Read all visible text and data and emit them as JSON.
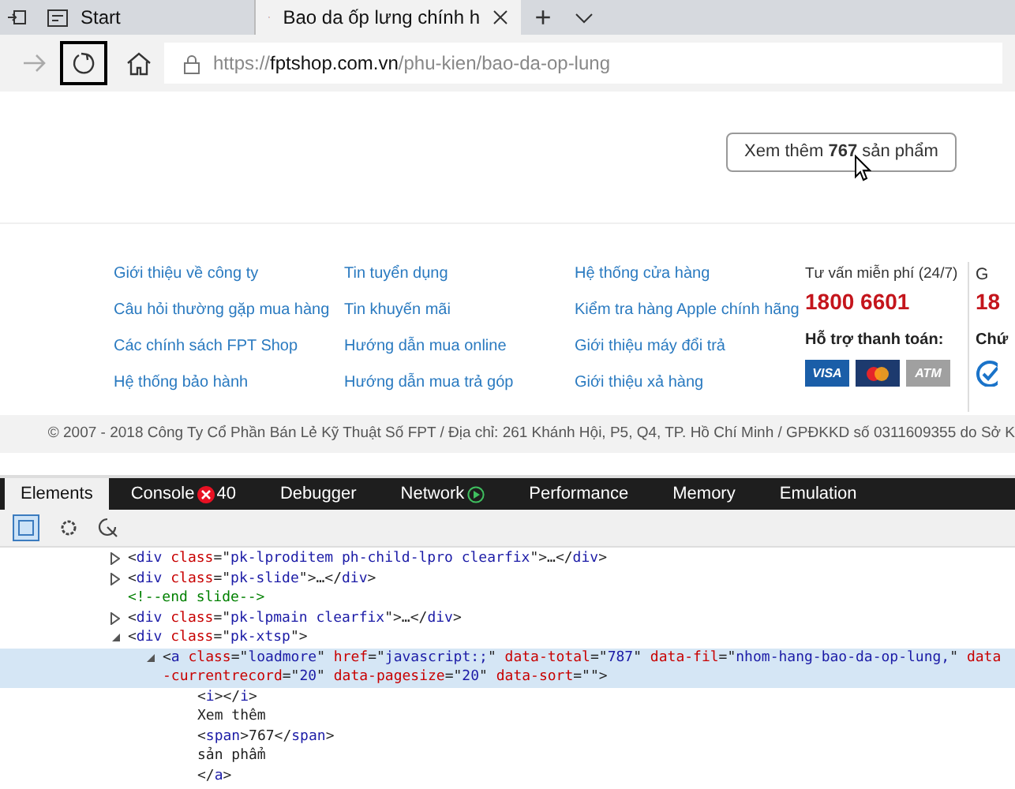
{
  "browser_tabs": [
    {
      "kind": "start",
      "label": "Start",
      "selected": false
    },
    {
      "kind": "page",
      "label": "Bao da ốp lưng chính h",
      "selected": true
    }
  ],
  "new_tab_button": "+",
  "address_bar": {
    "url_host_prefix": "https://",
    "url_host": "fptshop.com.vn",
    "url_path": "/phu-kien/bao-da-op-lung"
  },
  "load_more_button": "Xem thêm **767** sản phẩm",
  "footer": {
    "link_columns": [
      [
        "Giới thiệu về công ty",
        "Câu hỏi thường gặp mua hàng",
        "Các chính sách FPT Shop",
        "Hệ thống bảo hành"
      ],
      [
        "Tin tuyển dụng",
        "Tin khuyến mãi",
        "Hướng dẫn mua online",
        "Hướng dẫn mua trả góp"
      ],
      [
        "Hệ thống cửa hàng",
        "Kiểm tra hàng Apple chính hãng",
        "Giới thiệu máy đổi trả",
        "Giới thiệu xả hàng"
      ]
    ],
    "hotline_label": "Tư vấn miễn phí (24/7)",
    "hotline_number": "1800 6601",
    "payment_label": "Hỗ trợ thanh toán:",
    "payment_methods": [
      {
        "label": "VISA",
        "color": "#1a5ea8"
      },
      {
        "color": "#1d3a6e"
      },
      {
        "label": "ATM",
        "color": "#a0a0a0"
      }
    ],
    "cut_column": {
      "heading": "G",
      "number": "18",
      "payment_label": "Chứ"
    },
    "copyright": "© 2007 - 2018 Công Ty Cổ Phần Bán Lẻ Kỹ Thuật Số FPT / Địa chỉ: 261 Khánh Hội, P5, Q4, TP. Hồ Chí Minh / GPĐKKD số 0311609355 do Sở K"
  },
  "devtools": {
    "tabs": [
      {
        "label": "Elements",
        "selected": true
      },
      {
        "label": "Console",
        "selected": false,
        "error_count": "40"
      },
      {
        "label": "Debugger",
        "selected": false
      },
      {
        "label": "Network",
        "selected": false,
        "recording": true
      },
      {
        "label": "Performance",
        "selected": false
      },
      {
        "label": "Memory",
        "selected": false
      },
      {
        "label": "Emulation",
        "selected": false
      }
    ],
    "dom_tree": [
      {
        "kind": "parent",
        "expanded": false,
        "selected": false,
        "tokens": [
          {
            "kind": "punct",
            "text": "<"
          },
          {
            "kind": "tag",
            "text": "div"
          },
          {
            "kind": "attr",
            "text": " class"
          },
          {
            "kind": "punct",
            "text": "=\""
          },
          {
            "kind": "value",
            "text": "pk-lproditem ph-child-lpro clearfix"
          },
          {
            "kind": "punct",
            "text": "\">…</"
          },
          {
            "kind": "tag",
            "text": "div"
          },
          {
            "kind": "punct",
            "text": ">"
          }
        ]
      },
      {
        "kind": "parent",
        "expanded": false,
        "selected": false,
        "tokens": [
          {
            "kind": "punct",
            "text": "<"
          },
          {
            "kind": "tag",
            "text": "div"
          },
          {
            "kind": "attr",
            "text": " class"
          },
          {
            "kind": "punct",
            "text": "=\""
          },
          {
            "kind": "value",
            "text": "pk-slide"
          },
          {
            "kind": "punct",
            "text": "\">…</"
          },
          {
            "kind": "tag",
            "text": "div"
          },
          {
            "kind": "punct",
            "text": ">"
          }
        ]
      },
      {
        "kind": "leaf",
        "selected": false,
        "tokens": [
          {
            "kind": "comment",
            "text": "<!--end slide-->"
          }
        ]
      },
      {
        "kind": "parent",
        "expanded": false,
        "selected": false,
        "tokens": [
          {
            "kind": "punct",
            "text": "<"
          },
          {
            "kind": "tag",
            "text": "div"
          },
          {
            "kind": "attr",
            "text": " class"
          },
          {
            "kind": "punct",
            "text": "=\""
          },
          {
            "kind": "value",
            "text": "pk-lpmain clearfix"
          },
          {
            "kind": "punct",
            "text": "\">…</"
          },
          {
            "kind": "tag",
            "text": "div"
          },
          {
            "kind": "punct",
            "text": ">"
          }
        ]
      },
      {
        "kind": "parent",
        "expanded": true,
        "selected": false,
        "tokens": [
          {
            "kind": "punct",
            "text": "<"
          },
          {
            "kind": "tag",
            "text": "div"
          },
          {
            "kind": "attr",
            "text": " class"
          },
          {
            "kind": "punct",
            "text": "=\""
          },
          {
            "kind": "value",
            "text": "pk-xtsp"
          },
          {
            "kind": "punct",
            "text": "\">"
          }
        ],
        "children": [
          {
            "kind": "parent",
            "expanded": true,
            "selected": true,
            "tokens": [
              {
                "kind": "punct",
                "text": "<"
              },
              {
                "kind": "tag",
                "text": "a"
              },
              {
                "kind": "attr",
                "text": " class"
              },
              {
                "kind": "punct",
                "text": "=\""
              },
              {
                "kind": "value",
                "text": "loadmore"
              },
              {
                "kind": "punct",
                "text": "\""
              },
              {
                "kind": "attr",
                "text": " href"
              },
              {
                "kind": "punct",
                "text": "=\""
              },
              {
                "kind": "value",
                "text": "javascript:;"
              },
              {
                "kind": "punct",
                "text": "\""
              },
              {
                "kind": "attr",
                "text": " data-total"
              },
              {
                "kind": "punct",
                "text": "=\""
              },
              {
                "kind": "value",
                "text": "787"
              },
              {
                "kind": "punct",
                "text": "\""
              },
              {
                "kind": "attr",
                "text": " data-fil"
              },
              {
                "kind": "punct",
                "text": "=\""
              },
              {
                "kind": "value",
                "text": "nhom-hang-bao-da-op-lung,"
              },
              {
                "kind": "punct",
                "text": "\""
              },
              {
                "kind": "attr",
                "text": " data-currentrecord"
              },
              {
                "kind": "punct",
                "text": "=\""
              },
              {
                "kind": "value",
                "text": "20"
              },
              {
                "kind": "punct",
                "text": "\""
              },
              {
                "kind": "attr",
                "text": " data-pagesize"
              },
              {
                "kind": "punct",
                "text": "=\""
              },
              {
                "kind": "value",
                "text": "20"
              },
              {
                "kind": "punct",
                "text": "\""
              },
              {
                "kind": "attr",
                "text": " data-sort"
              },
              {
                "kind": "punct",
                "text": "=\"\">"
              }
            ],
            "children": [
              {
                "kind": "leaf",
                "selected": false,
                "tokens": [
                  {
                    "kind": "punct",
                    "text": "<"
                  },
                  {
                    "kind": "tag",
                    "text": "i"
                  },
                  {
                    "kind": "punct",
                    "text": "></"
                  },
                  {
                    "kind": "tag",
                    "text": "i"
                  },
                  {
                    "kind": "punct",
                    "text": ">"
                  }
                ]
              },
              {
                "kind": "leaf",
                "selected": false,
                "tokens": [
                  {
                    "kind": "text",
                    "text": "Xem thêm"
                  }
                ]
              },
              {
                "kind": "leaf",
                "selected": false,
                "tokens": [
                  {
                    "kind": "punct",
                    "text": "<"
                  },
                  {
                    "kind": "tag",
                    "text": "span"
                  },
                  {
                    "kind": "punct",
                    "text": ">"
                  },
                  {
                    "kind": "text",
                    "text": "767"
                  },
                  {
                    "kind": "punct",
                    "text": "</"
                  },
                  {
                    "kind": "tag",
                    "text": "span"
                  },
                  {
                    "kind": "punct",
                    "text": ">"
                  }
                ]
              },
              {
                "kind": "leaf",
                "selected": false,
                "tokens": [
                  {
                    "kind": "text",
                    "text": "sản phẩm"
                  }
                ]
              },
              {
                "kind": "leaf",
                "selected": false,
                "tokens": [
                  {
                    "kind": "punct",
                    "text": "</"
                  },
                  {
                    "kind": "tag",
                    "text": "a"
                  },
                  {
                    "kind": "punct",
                    "text": ">"
                  }
                ]
              }
            ]
          }
        ]
      }
    ]
  }
}
